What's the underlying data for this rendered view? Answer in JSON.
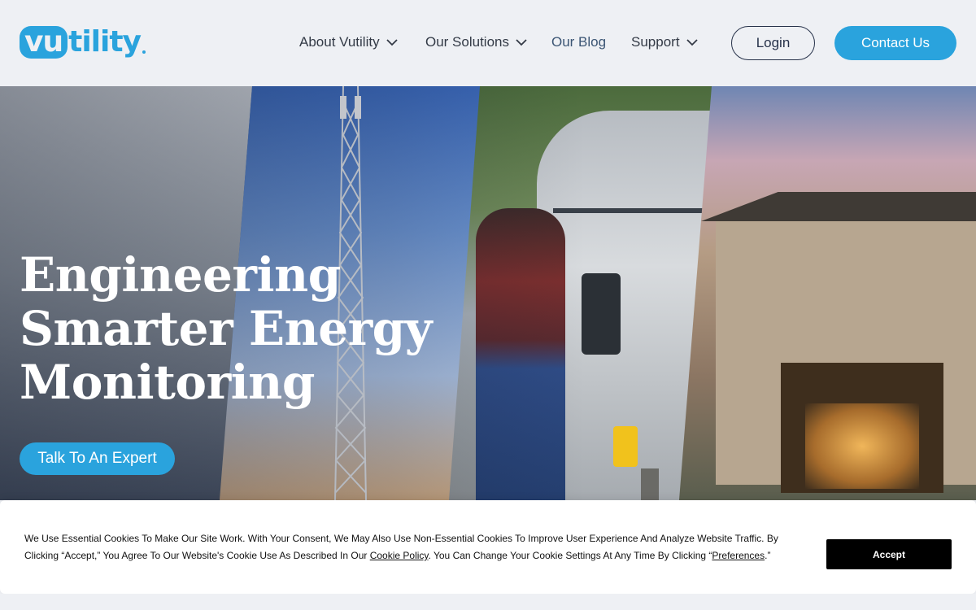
{
  "header": {
    "logo": {
      "part1": "vu",
      "part2": "tility"
    },
    "nav": [
      {
        "label": "About Vutility",
        "has_dropdown": true
      },
      {
        "label": "Our Solutions",
        "has_dropdown": true
      },
      {
        "label": "Our Blog",
        "has_dropdown": false
      },
      {
        "label": "Support",
        "has_dropdown": true
      }
    ],
    "login_label": "Login",
    "contact_label": "Contact Us"
  },
  "hero": {
    "title_lines": [
      "Engineering",
      "Smarter Energy",
      "Monitoring"
    ],
    "cta_label": "Talk To An Expert"
  },
  "cookie_banner": {
    "text_part1": "We Use Essential Cookies To Make Our Site Work. With Your Consent, We May Also Use Non-Essential Cookies To Improve User Experience And Analyze Website Traffic. By Clicking “Accept,” You Agree To Our Website's Cookie Use As Described In Our ",
    "cookie_policy_link": "Cookie Policy",
    "text_part2": ". You Can Change Your Cookie Settings At Any Time By Clicking “",
    "preferences_link": "Preferences",
    "text_part3": ".”",
    "accept_label": "Accept"
  },
  "colors": {
    "brand_blue": "#2aa3dd",
    "header_bg": "#eef0f4",
    "nav_text": "#333a46",
    "accept_bg": "#000000"
  },
  "icons": {
    "dropdown": "chevron-down-icon"
  }
}
